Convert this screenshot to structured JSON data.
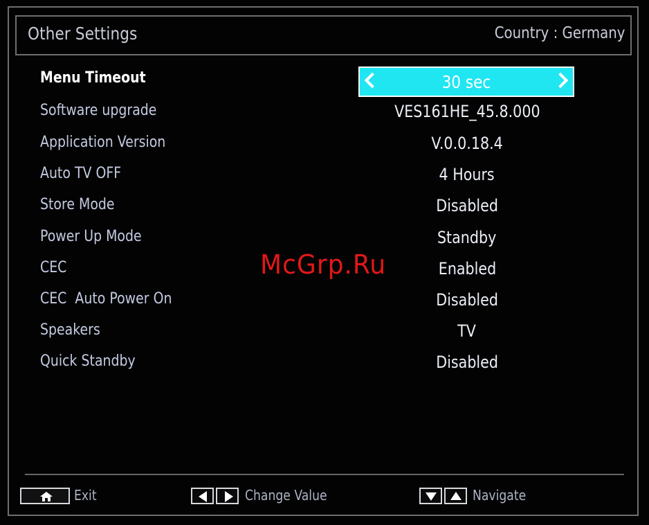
{
  "header": {
    "title": "Other Settings",
    "country": "Country : Germany"
  },
  "settings": [
    {
      "label": "Menu Timeout",
      "value": "30 sec",
      "selected": true
    },
    {
      "label": "Software upgrade",
      "value": "VES161HE_45.8.000"
    },
    {
      "label": "Application Version",
      "value": "V.0.0.18.4"
    },
    {
      "label": "Auto TV OFF",
      "value": "4 Hours"
    },
    {
      "label": "Store Mode",
      "value": "Disabled"
    },
    {
      "label": "Power Up Mode",
      "value": "Standby"
    },
    {
      "label": "CEC",
      "value": "Enabled"
    },
    {
      "label": "CEC  Auto Power On",
      "value": "Disabled"
    },
    {
      "label": "Speakers",
      "value": "TV"
    },
    {
      "label": "Quick Standby",
      "value": "Disabled"
    }
  ],
  "watermark": "McGrp.Ru",
  "footer": {
    "exit_label": "Exit",
    "change_value_label": "Change Value",
    "navigate_label": "Navigate"
  },
  "icons": {
    "home": "home-icon",
    "left": "arrow-left-icon",
    "right": "arrow-right-icon",
    "down": "arrow-down-icon",
    "up": "arrow-up-icon",
    "prev": "chevron-left-icon",
    "next": "chevron-right-icon"
  },
  "colors": {
    "highlight": "#20e6f2",
    "watermark": "#e31818",
    "background": "#030304",
    "frame": "#6f6f73"
  }
}
